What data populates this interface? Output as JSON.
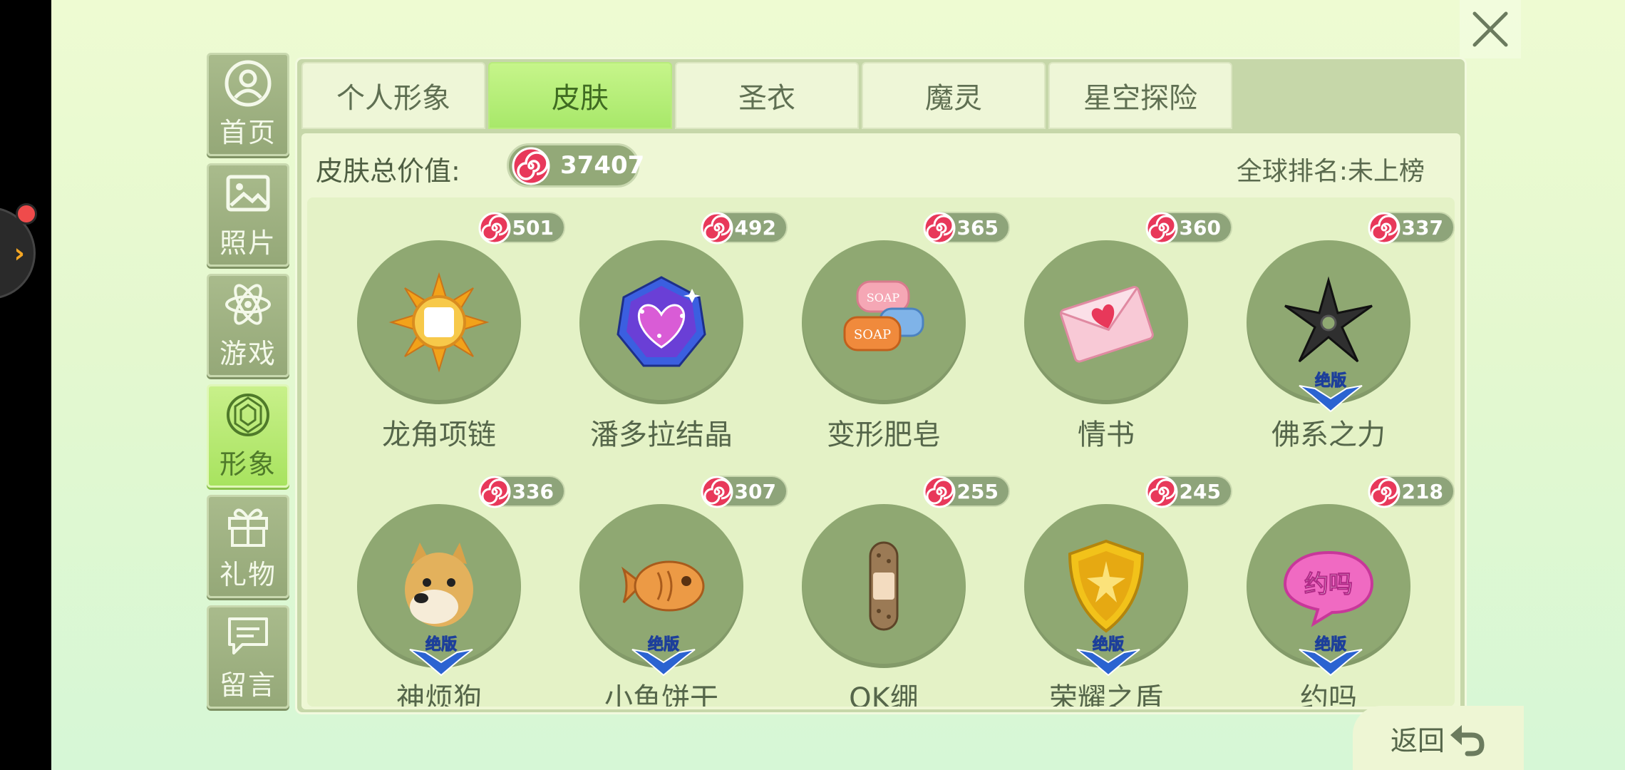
{
  "sidebar": {
    "items": [
      {
        "label": "首页",
        "icon": "profile-icon"
      },
      {
        "label": "照片",
        "icon": "photo-icon"
      },
      {
        "label": "游戏",
        "icon": "atom-icon"
      },
      {
        "label": "形象",
        "icon": "gem-icon",
        "active": true
      },
      {
        "label": "礼物",
        "icon": "gift-icon"
      },
      {
        "label": "留言",
        "icon": "message-icon"
      }
    ]
  },
  "tabs": [
    {
      "label": "个人形象"
    },
    {
      "label": "皮肤",
      "active": true
    },
    {
      "label": "圣衣"
    },
    {
      "label": "魔灵"
    },
    {
      "label": "星空探险"
    }
  ],
  "summary": {
    "label": "皮肤总价值:",
    "total_value": "37407",
    "rank_text": "全球排名:未上榜"
  },
  "limited_label": "绝版",
  "items": [
    {
      "name": "龙角项链",
      "value": "501",
      "icon": "sun-necklace-icon",
      "limited": false
    },
    {
      "name": "潘多拉结晶",
      "value": "492",
      "icon": "crystal-heart-icon",
      "limited": false
    },
    {
      "name": "变形肥皂",
      "value": "365",
      "icon": "soap-icon",
      "limited": false
    },
    {
      "name": "情书",
      "value": "360",
      "icon": "love-letter-icon",
      "limited": false
    },
    {
      "name": "佛系之力",
      "value": "337",
      "icon": "shuriken-icon",
      "limited": true
    },
    {
      "name": "神烦狗",
      "value": "336",
      "icon": "doge-icon",
      "limited": true
    },
    {
      "name": "小鱼饼干",
      "value": "307",
      "icon": "fish-cookie-icon",
      "limited": true
    },
    {
      "name": "OK绷",
      "value": "255",
      "icon": "bandage-icon",
      "limited": false
    },
    {
      "name": "荣耀之盾",
      "value": "245",
      "icon": "gold-shield-icon",
      "limited": true
    },
    {
      "name": "约吗",
      "value": "218",
      "icon": "chat-bubble-icon",
      "limited": true
    }
  ],
  "stamp_text": {
    "soap": "SOAP",
    "chat_bubble": "约吗"
  },
  "back_label": "返回",
  "colors": {
    "active_tab": "#a8e86a",
    "panel": "#c6d7a9",
    "circle": "#8fa872",
    "candy": "#e8385a"
  }
}
